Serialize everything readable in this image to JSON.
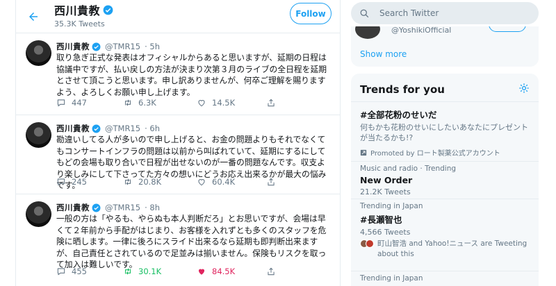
{
  "header": {
    "name": "西川貴教",
    "tweet_count": "35.3K Tweets",
    "follow_label": "Follow"
  },
  "tweets": [
    {
      "name": "西川貴教",
      "handle": "@TMR15",
      "time": "· 5h",
      "text": "取り急ぎ正式な発表はオフィシャルからあると思いますが、延期の日程は協議中ですが、払い戻しの方法が決まり次第３月のライブの全日程を延期とさせて頂こうと思います。申し訳ありませんが、何卒ご理解を賜りますよう、よろしくお願い申し上げます。",
      "replies": "447",
      "retweets": "6.3K",
      "likes": "14.5K",
      "retweeted": false,
      "liked": false
    },
    {
      "name": "西川貴教",
      "handle": "@TMR15",
      "time": "· 6h",
      "text": "勘違いしてる人が多いので申し上げると、お金の問題よりもそれでなくてもコンサートインフラの問題は以前から叫ばれていて、延期にするにしてもどの会場も取り合いで日程が出せないのが一番の問題なんです。収支より楽しみにして下さってた方々の想いにどうお応え出来るかが最大の悩みです。",
      "replies": "245",
      "retweets": "20.8K",
      "likes": "60.4K",
      "retweeted": false,
      "liked": false
    },
    {
      "name": "西川貴教",
      "handle": "@TMR15",
      "time": "· 8h",
      "text": "一般の方は「やるも、やらぬも本人判断だろ」とお思いですが、会場は早くて２年前から手配がはじまり、お客様を入れずとも多くのスタッフを危険に晒します。一律に後ろにスライド出来るなら延期も即判断出来ますが、自己責任とされているので足並みは揃いません。保険もリスクを取って加入は難しいです。",
      "replies": "455",
      "retweets": "30.1K",
      "likes": "84.5K",
      "retweeted": true,
      "liked": true
    }
  ],
  "sidebar": {
    "search_placeholder": "Search Twitter",
    "who_to_follow": {
      "handle": "@YoshikiOfficial",
      "show_more": "Show more"
    },
    "trends_title": "Trends for you",
    "trends": [
      {
        "name": "#全部花粉のせいだ",
        "description": "何もかも花粉のせいにしたいあなたにプレゼントが当たるかも!?",
        "promoted": "Promoted by ロート製薬公式アカウント"
      },
      {
        "meta": "Music and radio · Trending",
        "name": "New Order",
        "count": "21.2K Tweets"
      },
      {
        "meta": "Trending in Japan",
        "name": "#長瀬智也",
        "count": "4,566 Tweets",
        "people": "町山智浩 and Yahoo!ニュース are Tweeting about this"
      },
      {
        "meta": "Trending in Japan"
      }
    ]
  },
  "colors": {
    "accent": "#1da1f2",
    "retweet_active": "#17bf63",
    "like_active": "#e0245e",
    "muted": "#657786"
  }
}
